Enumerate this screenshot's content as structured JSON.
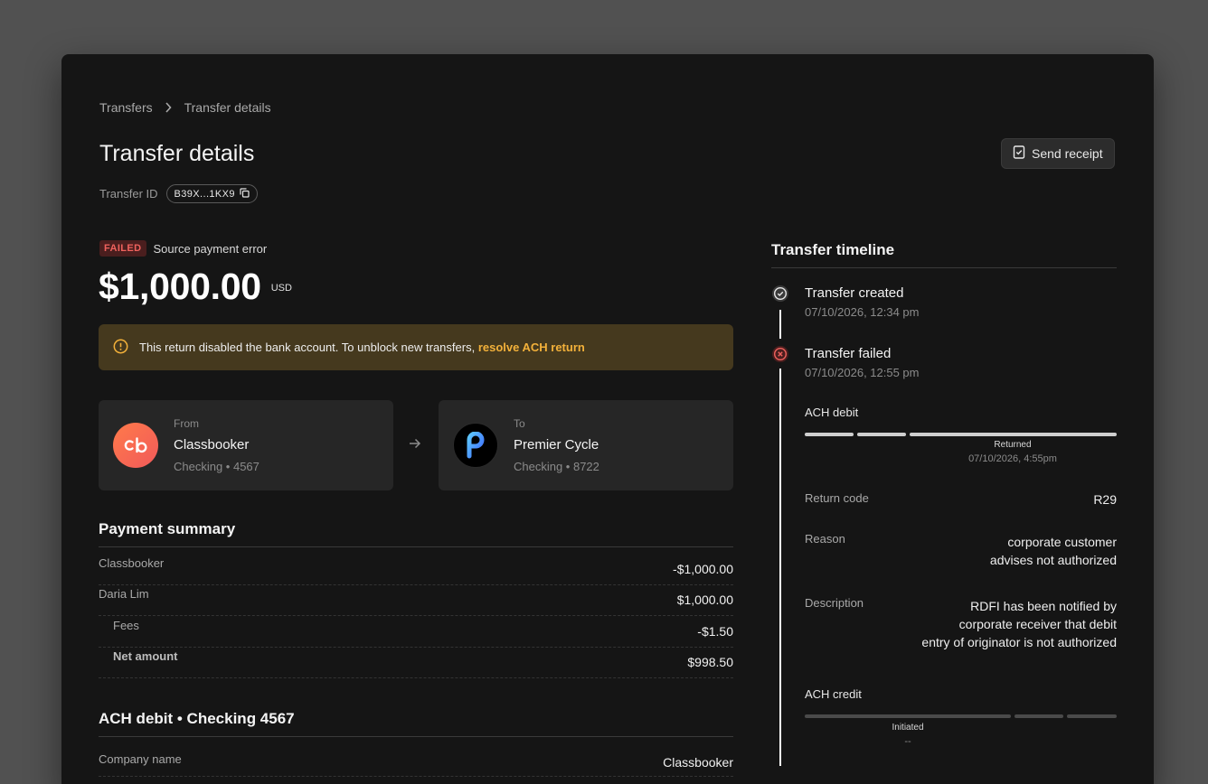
{
  "breadcrumb": {
    "root": "Transfers",
    "current": "Transfer details"
  },
  "header": {
    "title": "Transfer details",
    "send_receipt_label": "Send receipt"
  },
  "transfer_id": {
    "label": "Transfer ID",
    "value": "B39X...1KX9"
  },
  "status": {
    "badge": "FAILED",
    "text": "Source payment error",
    "color": "#f0625e"
  },
  "amount": {
    "value": "$1,000.00",
    "currency": "USD"
  },
  "alert": {
    "text": "This return disabled the bank account. To unblock new transfers,",
    "link": "resolve ACH return",
    "accent": "#f3b13a"
  },
  "from": {
    "label": "From",
    "name": "Classbooker",
    "account": "Checking • 4567",
    "logo": "classbooker-logo"
  },
  "to": {
    "label": "To",
    "name": "Premier Cycle",
    "account": "Checking • 8722",
    "logo": "premier-cycle-logo"
  },
  "payment_summary": {
    "title": "Payment summary",
    "rows": [
      {
        "label": "Classbooker",
        "value": "-$1,000.00"
      },
      {
        "label": "Daria Lim",
        "value": "$1,000.00"
      },
      {
        "label": "Fees",
        "value": "-$1.50"
      },
      {
        "label": "Net amount",
        "value": "$998.50"
      }
    ]
  },
  "ach_debit_section": {
    "title": "ACH debit • Checking 4567",
    "rows": [
      {
        "label": "Company name",
        "value": "Classbooker"
      }
    ]
  },
  "timeline": {
    "title": "Transfer timeline",
    "events": [
      {
        "title": "Transfer created",
        "date": "07/10/2026, 12:34 pm",
        "icon": "check-circle-icon"
      },
      {
        "title": "Transfer failed",
        "date": "07/10/2026, 12:55 pm",
        "icon": "x-circle-icon"
      }
    ],
    "ach_debit": {
      "label": "ACH debit",
      "marker": "Returned",
      "marker_date": "07/10/2026, 4:55pm",
      "details": [
        {
          "key": "Return code",
          "value": "R29"
        },
        {
          "key": "Reason",
          "value": "corporate customer\nadvises not authorized"
        },
        {
          "key": "Description",
          "value": "RDFI has been notified by\ncorporate receiver that debit\nentry of originator is not authorized"
        }
      ]
    },
    "ach_credit": {
      "label": "ACH credit",
      "marker": "Initiated",
      "marker_date": "--"
    }
  }
}
